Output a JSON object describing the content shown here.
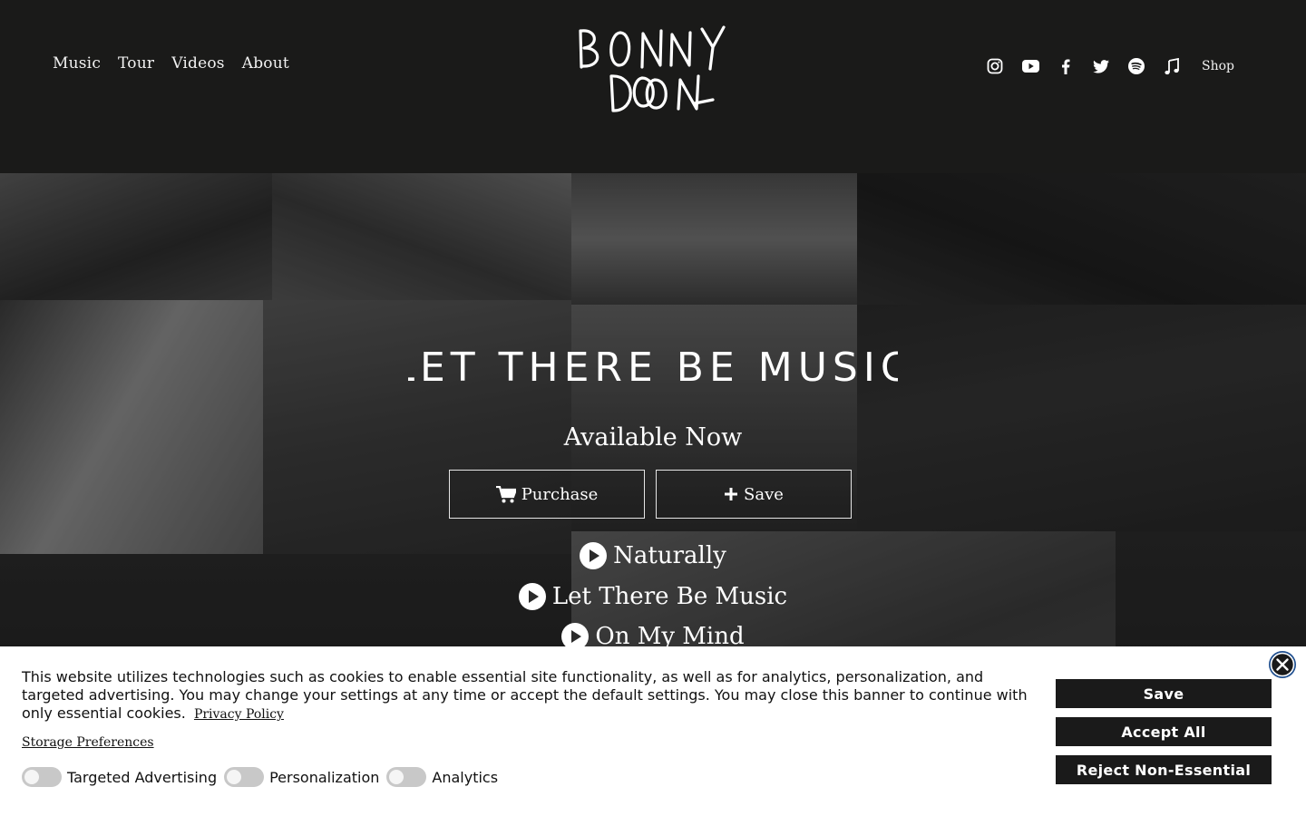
{
  "header": {
    "nav": [
      "Music",
      "Tour",
      "Videos",
      "About"
    ],
    "logo_text": "BONNY DOON",
    "social_icons": [
      "instagram-icon",
      "youtube-icon",
      "facebook-icon",
      "twitter-icon",
      "spotify-icon",
      "music-note-icon"
    ],
    "shop_label": "Shop"
  },
  "hero": {
    "album_title": "LET THERE BE MUSIC",
    "availability": "Available Now",
    "purchase_label": "Purchase",
    "save_label": "Save",
    "tracks": [
      "Naturally",
      "Let There Be Music",
      "On My Mind"
    ]
  },
  "cookie_banner": {
    "message": "This website utilizes technologies such as cookies to enable essential site functionality, as well as for analytics, personalization, and targeted advertising. You may change your settings at any time or accept the default settings. You may close this banner to continue with only essential cookies.",
    "privacy_link": "Privacy Policy",
    "storage_preferences": "Storage Preferences",
    "toggles": [
      "Targeted Advertising",
      "Personalization",
      "Analytics"
    ],
    "save_label": "Save",
    "accept_label": "Accept All",
    "reject_label": "Reject Non-Essential"
  },
  "colors": {
    "header_bg": "#1a1a19",
    "banner_bg": "#ffffff",
    "button_bg": "#1a1a1a",
    "close_accent": "#1f4f8f"
  }
}
